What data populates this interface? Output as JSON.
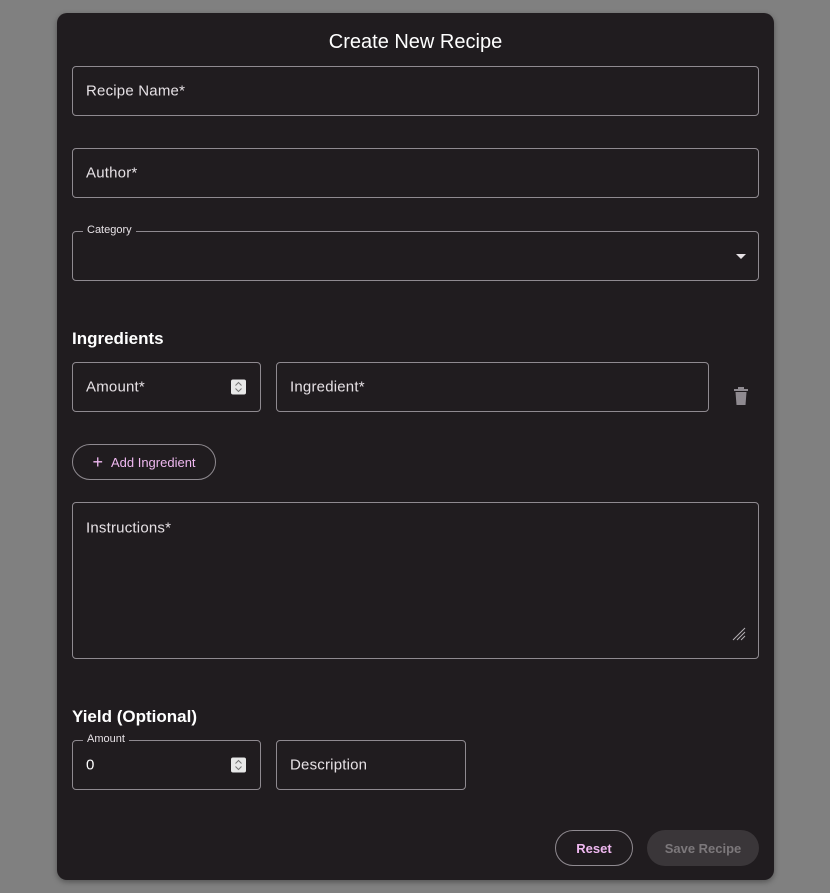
{
  "form": {
    "title": "Create New Recipe",
    "recipe_name_label": "Recipe Name*",
    "author_label": "Author*",
    "category_label": "Category",
    "category_value": "",
    "instructions_label": "Instructions*"
  },
  "ingredients": {
    "heading": "Ingredients",
    "amount_label": "Amount*",
    "ingredient_label": "Ingredient*",
    "add_label": "Add Ingredient"
  },
  "yield": {
    "heading": "Yield (Optional)",
    "amount_label": "Amount",
    "amount_value": "0",
    "description_label": "Description"
  },
  "actions": {
    "reset_label": "Reset",
    "save_label": "Save Recipe"
  },
  "colors": {
    "background": "#808080",
    "card": "#201c1f",
    "accent": "#efb8f0",
    "outline": "#8f8a90"
  },
  "icons": [
    "chevron-down-icon",
    "delete-icon",
    "plus-icon",
    "resize-handle-icon",
    "spinner-icon"
  ]
}
